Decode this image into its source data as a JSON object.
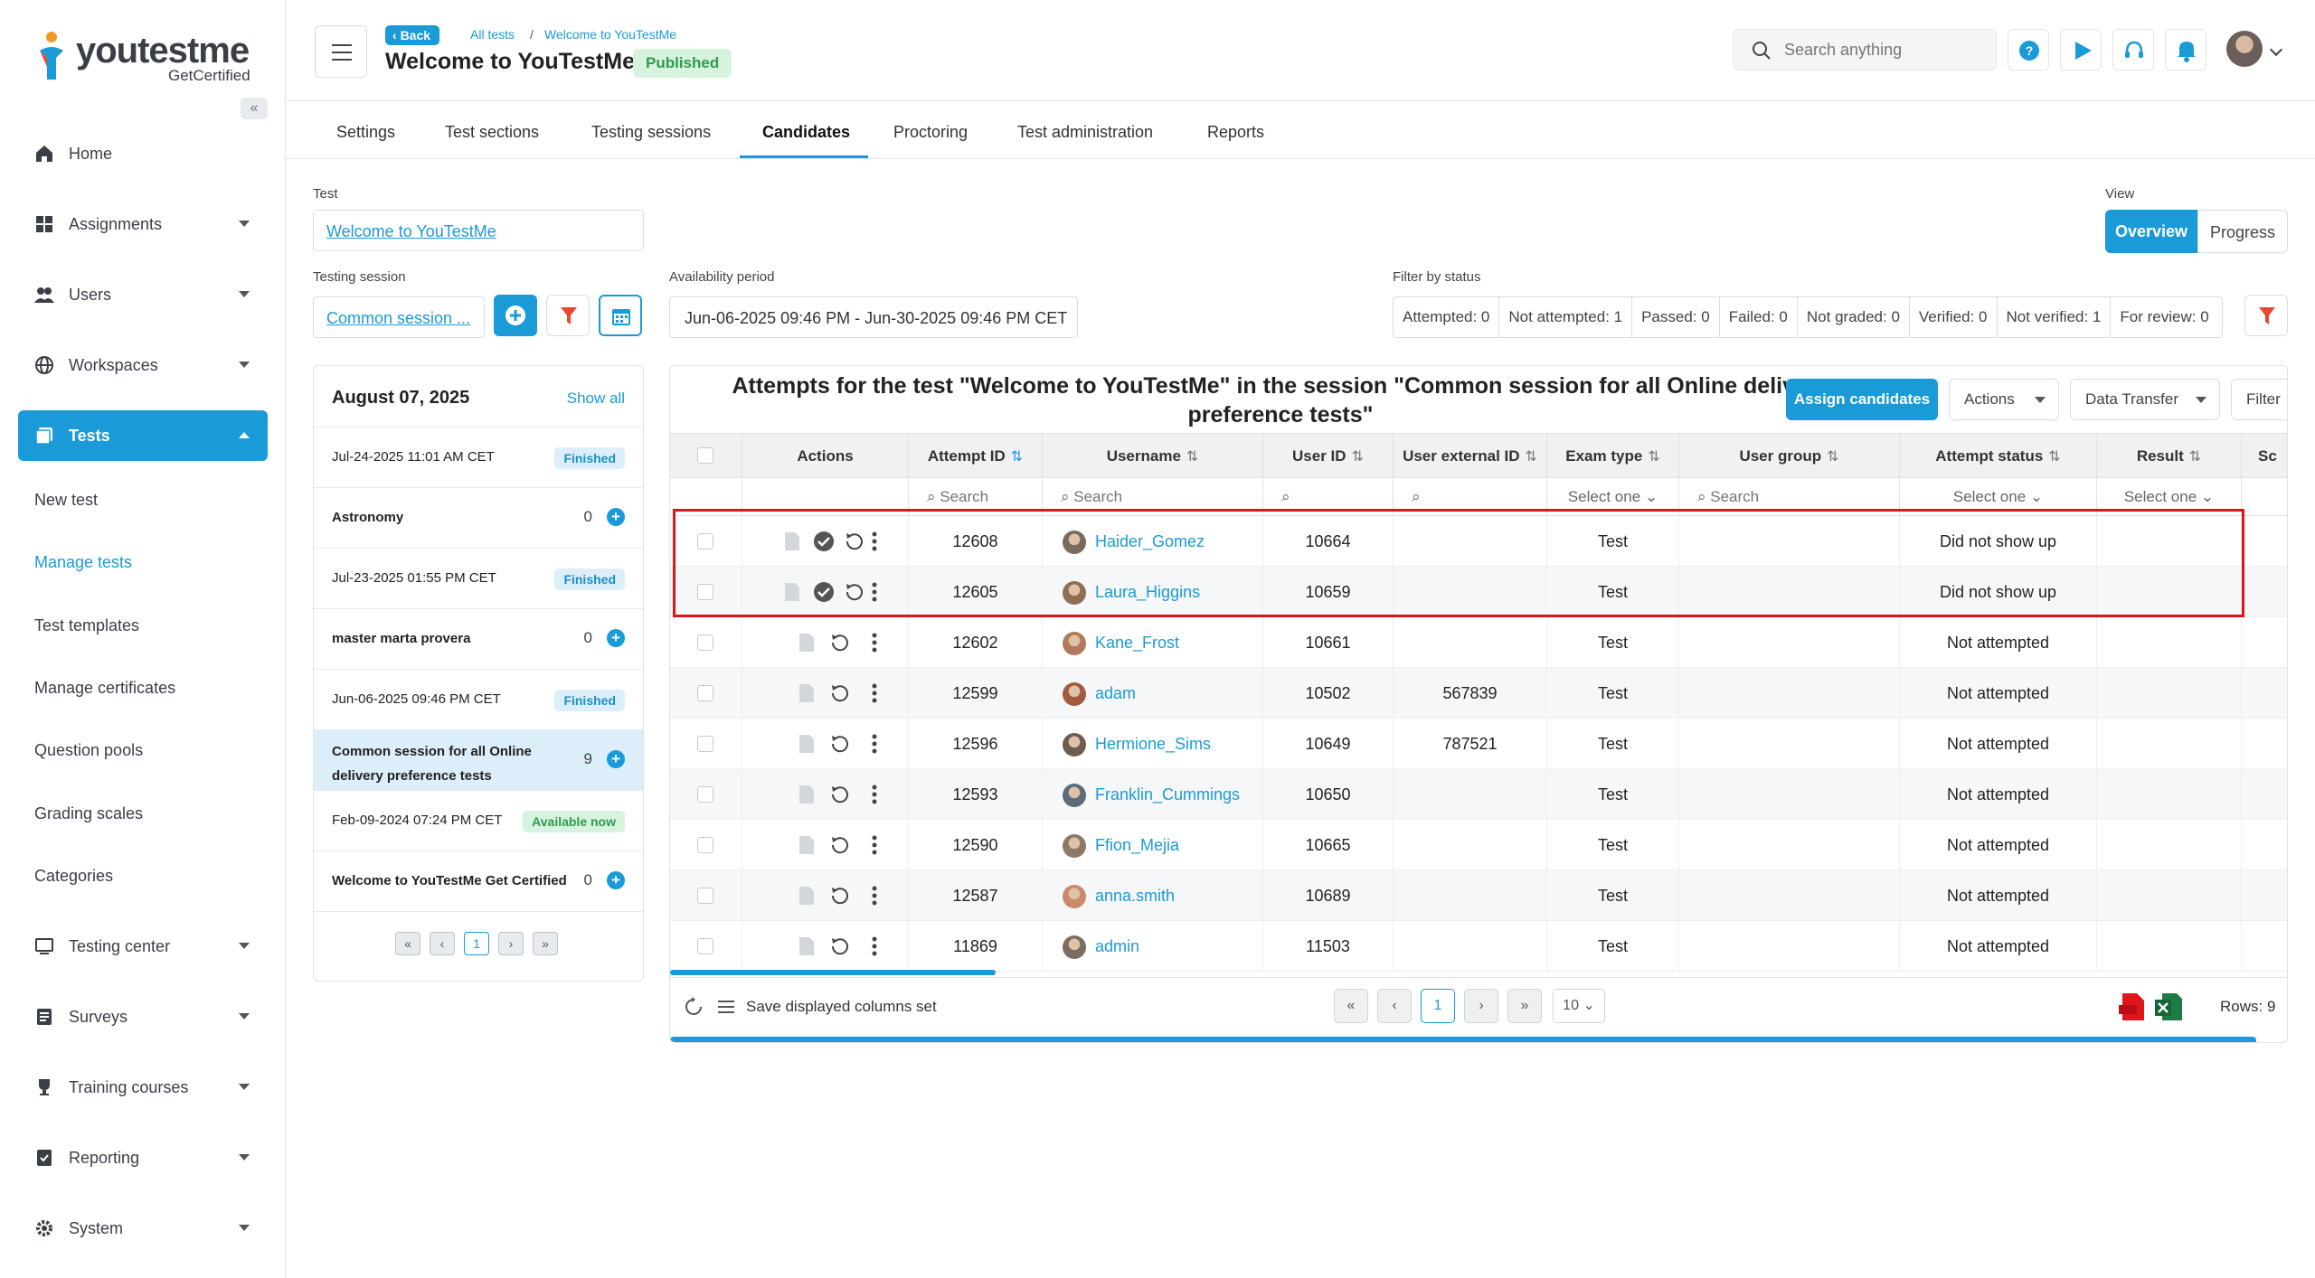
{
  "logo": {
    "text_main": "youtestme",
    "text_sub": "GetCertified"
  },
  "sidebar": {
    "items": [
      {
        "label": "Home",
        "icon": "home-icon"
      },
      {
        "label": "Assignments",
        "icon": "assignments-icon"
      },
      {
        "label": "Users",
        "icon": "users-icon"
      },
      {
        "label": "Workspaces",
        "icon": "globe-icon"
      },
      {
        "label": "Tests",
        "icon": "tests-icon"
      },
      {
        "label": "Testing center",
        "icon": "testing-center-icon"
      },
      {
        "label": "Surveys",
        "icon": "surveys-icon"
      },
      {
        "label": "Training courses",
        "icon": "trophy-icon"
      },
      {
        "label": "Reporting",
        "icon": "reporting-icon"
      },
      {
        "label": "System",
        "icon": "gear-icon"
      }
    ],
    "tests_sub": [
      "New test",
      "Manage tests",
      "Test templates",
      "Manage certificates",
      "Question pools",
      "Grading scales",
      "Categories"
    ]
  },
  "header": {
    "back_label": "Back",
    "crumb_1": "All tests",
    "crumb_sep": "/",
    "crumb_2": "Welcome to YouTestMe",
    "title": "Welcome to YouTestMe",
    "status_badge": "Published",
    "search_placeholder": "Search anything"
  },
  "tabs": [
    "Settings",
    "Test sections",
    "Testing sessions",
    "Candidates",
    "Proctoring",
    "Test administration",
    "Reports"
  ],
  "filters": {
    "test_label": "Test",
    "test_value": "Welcome to YouTestMe",
    "session_label": "Testing session",
    "session_value": "Common session ...",
    "availability_label": "Availability period",
    "availability_value": "Jun-06-2025 09:46 PM - Jun-30-2025 09:46 PM CET",
    "filter_status_label": "Filter by status",
    "statuses": [
      "Attempted: 0",
      "Not attempted: 1",
      "Passed: 0",
      "Failed: 0",
      "Not graded: 0",
      "Verified: 0",
      "Not verified: 1",
      "For review: 0"
    ],
    "view_label": "View",
    "view_overview": "Overview",
    "view_progress": "Progress"
  },
  "sessions_panel": {
    "date": "August 07, 2025",
    "show_all": "Show all",
    "rows": [
      {
        "text": "Jul-24-2025 11:01 AM CET",
        "badge": "Finished"
      },
      {
        "text": "Astronomy",
        "count": "0"
      },
      {
        "text": "Jul-23-2025 01:55 PM CET",
        "badge": "Finished"
      },
      {
        "text": "master marta provera",
        "count": "0"
      },
      {
        "text": "Jun-06-2025 09:46 PM CET",
        "badge": "Finished"
      },
      {
        "text": "Common session for all Online delivery preference tests",
        "count": "9"
      },
      {
        "text": "Feb-09-2024 07:24 PM CET",
        "badge": "Available now"
      },
      {
        "text": "Welcome to YouTestMe Get Certified",
        "count": "0"
      }
    ],
    "page": "1"
  },
  "table": {
    "title": "Attempts for the test \"Welcome to YouTestMe\" in the session \"Common session for all Online delivery preference tests\"",
    "assign_label": "Assign candidates",
    "actions_label": "Actions",
    "data_transfer_label": "Data Transfer",
    "filter_label": "Filter",
    "columns": [
      "Actions",
      "Attempt ID",
      "Username",
      "User ID",
      "User external ID",
      "Exam type",
      "User group",
      "Attempt status",
      "Result",
      "Sc"
    ],
    "search_placeholder": "Search",
    "select_one": "Select one",
    "rows": [
      {
        "attempt_id": "12608",
        "username": "Haider_Gomez",
        "user_id": "10664",
        "ext_id": "",
        "exam_type": "Test",
        "status": "Did not show up",
        "check": true
      },
      {
        "attempt_id": "12605",
        "username": "Laura_Higgins",
        "user_id": "10659",
        "ext_id": "",
        "exam_type": "Test",
        "status": "Did not show up",
        "check": true
      },
      {
        "attempt_id": "12602",
        "username": "Kane_Frost",
        "user_id": "10661",
        "ext_id": "",
        "exam_type": "Test",
        "status": "Not attempted",
        "check": false
      },
      {
        "attempt_id": "12599",
        "username": "adam",
        "user_id": "10502",
        "ext_id": "567839",
        "exam_type": "Test",
        "status": "Not attempted",
        "check": false
      },
      {
        "attempt_id": "12596",
        "username": "Hermione_Sims",
        "user_id": "10649",
        "ext_id": "787521",
        "exam_type": "Test",
        "status": "Not attempted",
        "check": false
      },
      {
        "attempt_id": "12593",
        "username": "Franklin_Cummings",
        "user_id": "10650",
        "ext_id": "",
        "exam_type": "Test",
        "status": "Not attempted",
        "check": false
      },
      {
        "attempt_id": "12590",
        "username": "Ffion_Mejia",
        "user_id": "10665",
        "ext_id": "",
        "exam_type": "Test",
        "status": "Not attempted",
        "check": false
      },
      {
        "attempt_id": "12587",
        "username": "anna.smith",
        "user_id": "10689",
        "ext_id": "",
        "exam_type": "Test",
        "status": "Not attempted",
        "check": false
      },
      {
        "attempt_id": "11869",
        "username": "admin",
        "user_id": "11503",
        "ext_id": "",
        "exam_type": "Test",
        "status": "Not attempted",
        "check": false
      }
    ],
    "save_columns_label": "Save displayed columns set",
    "page": "1",
    "page_size": "10",
    "rows_count": "Rows: 9"
  },
  "colors": {
    "accent": "#1a9bd7",
    "highlight": "#e0141b",
    "published_bg": "#d6f3df"
  }
}
